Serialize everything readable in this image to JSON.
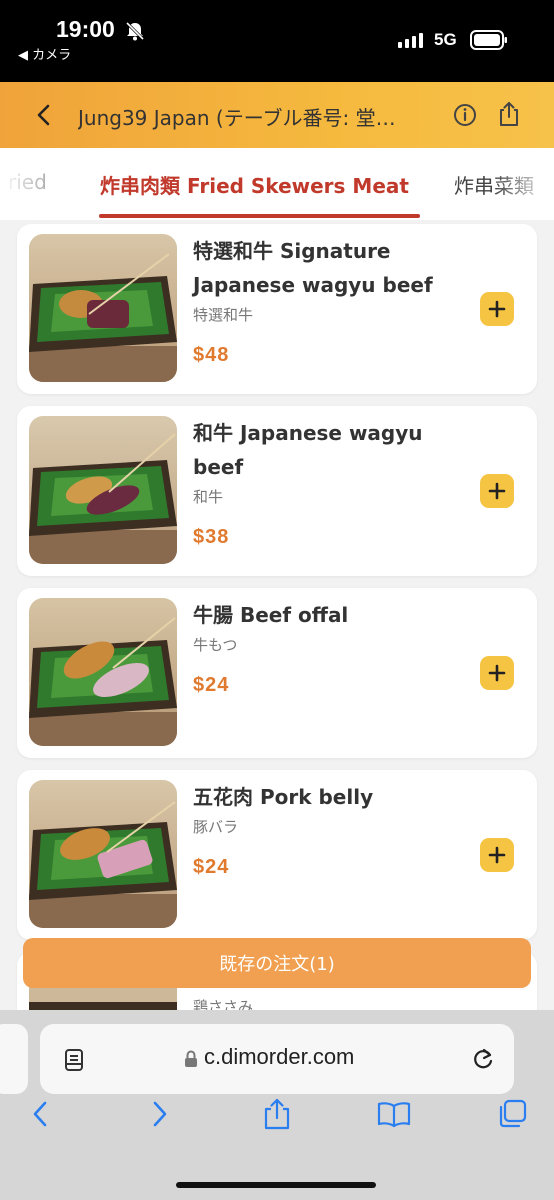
{
  "status_bar": {
    "time": "19:00",
    "back_app": "◀ カメラ",
    "network": "5G",
    "icons": [
      "bell-slash-icon",
      "signal-icon",
      "battery-icon"
    ]
  },
  "header": {
    "title": "Jung39 Japan (テーブル番号: 堂…",
    "icons": [
      "back-chevron-icon",
      "info-icon",
      "share-icon"
    ]
  },
  "tabs": [
    {
      "label": "ried"
    },
    {
      "label": "炸串肉類 Fried Skewers Meat",
      "active": true
    },
    {
      "label": "炸串菜類"
    }
  ],
  "items": [
    {
      "name": "特選和牛 Signature Japanese wagyu beef",
      "sub": "特選和牛",
      "price": "$48"
    },
    {
      "name": "和牛 Japanese wagyu beef",
      "sub": "和牛",
      "price": "$38"
    },
    {
      "name": "牛腸 Beef offal",
      "sub": "牛もつ",
      "price": "$24"
    },
    {
      "name": "五花肉 Pork belly",
      "sub": "豚バラ",
      "price": "$24"
    },
    {
      "name": "",
      "sub": "鶏ささみ",
      "price": ""
    }
  ],
  "order_bar": {
    "label": "既存の注文(1)"
  },
  "browser": {
    "url": "c.dimorder.com",
    "icons": [
      "reader-icon",
      "lock-icon",
      "reload-icon",
      "back-icon",
      "forward-icon",
      "share-icon",
      "bookmarks-icon",
      "tabs-icon"
    ]
  },
  "colors": {
    "accent": "#c0392b",
    "header": "#f5b93e",
    "price": "#e07a2f",
    "add_button": "#f6c443",
    "order_bar": "#f0a050"
  }
}
